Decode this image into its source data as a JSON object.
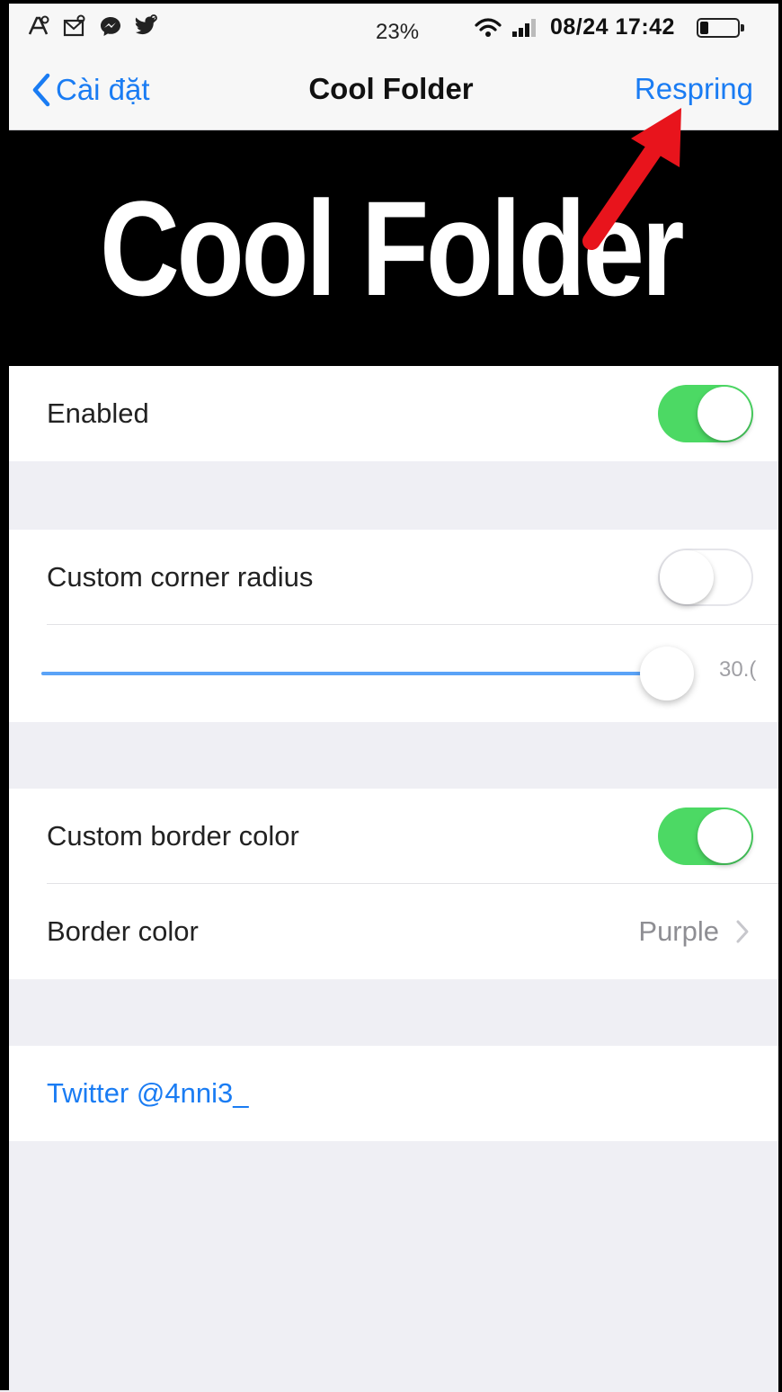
{
  "status_bar": {
    "battery_percent": "23%",
    "datetime": "08/24 17:42",
    "battery_level": 0.23,
    "icons": [
      "app-notification-icon",
      "mail-notification-icon",
      "messenger-icon",
      "twitter-icon",
      "wifi-icon",
      "signal-icon",
      "battery-icon"
    ]
  },
  "nav": {
    "back_label": "Cài đặt",
    "title": "Cool Folder",
    "action_label": "Respring"
  },
  "banner": {
    "text": "Cool Folder"
  },
  "groups": [
    {
      "rows": [
        {
          "label": "Enabled",
          "control": "switch",
          "on": true
        }
      ]
    },
    {
      "rows": [
        {
          "label": "Custom corner radius",
          "control": "switch",
          "on": false
        },
        {
          "control": "slider",
          "value_text": "30.(",
          "level": 1.0
        }
      ]
    },
    {
      "rows": [
        {
          "label": "Custom border color",
          "control": "switch",
          "on": true
        },
        {
          "label": "Border color",
          "control": "disclosure",
          "value": "Purple"
        }
      ]
    },
    {
      "rows": [
        {
          "label": "Twitter @4nni3_",
          "control": "link"
        }
      ]
    }
  ],
  "colors": {
    "accent": "#1a7cf3",
    "switch_on": "#4cd964",
    "background": "#efeff4",
    "annotation_arrow": "#e8141c"
  }
}
